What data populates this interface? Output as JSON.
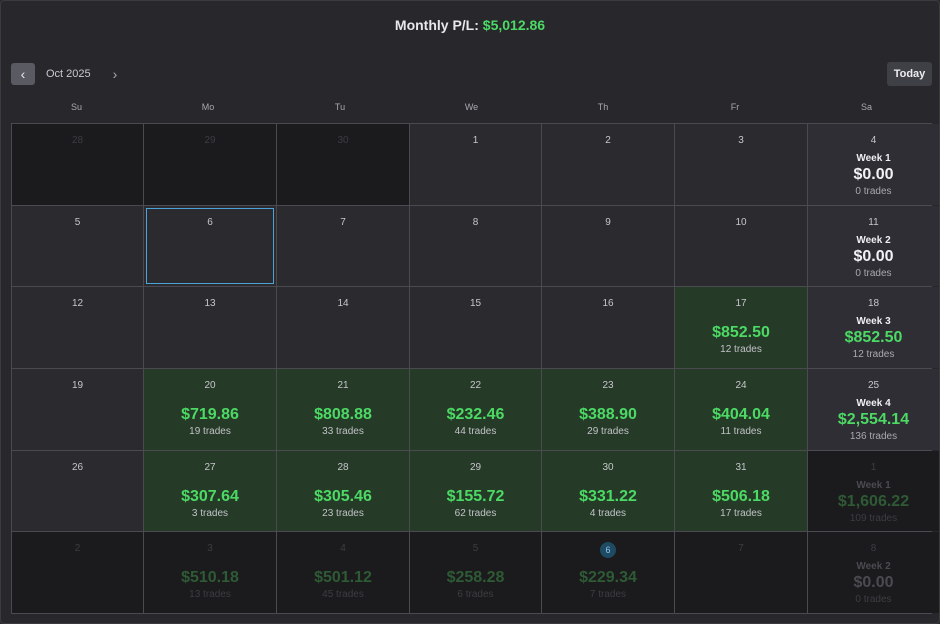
{
  "header": {
    "label": "Monthly P/L:",
    "amount": "$5,012.86",
    "positive_color": "#4cd964"
  },
  "nav": {
    "prev_icon": "chevron-left-icon",
    "next_icon": "chevron-right-icon",
    "month": "Oct 2025",
    "today_label": "Today"
  },
  "weekdays": [
    "Su",
    "Mo",
    "Tu",
    "We",
    "Th",
    "Fr",
    "Sa"
  ],
  "weeks": [
    {
      "days": [
        {
          "day": "28",
          "other": true
        },
        {
          "day": "29",
          "other": true
        },
        {
          "day": "30",
          "other": true
        },
        {
          "day": "1"
        },
        {
          "day": "2"
        },
        {
          "day": "3"
        }
      ],
      "summary": {
        "day": "4",
        "label": "Week 1",
        "pl": "$0.00",
        "trades": "0 trades",
        "pos": false
      }
    },
    {
      "days": [
        {
          "day": "5"
        },
        {
          "day": "6",
          "selected": true
        },
        {
          "day": "7"
        },
        {
          "day": "8"
        },
        {
          "day": "9"
        },
        {
          "day": "10"
        }
      ],
      "summary": {
        "day": "11",
        "label": "Week 2",
        "pl": "$0.00",
        "trades": "0 trades",
        "pos": false
      }
    },
    {
      "days": [
        {
          "day": "12"
        },
        {
          "day": "13"
        },
        {
          "day": "14"
        },
        {
          "day": "15"
        },
        {
          "day": "16"
        },
        {
          "day": "17",
          "pl": "$852.50",
          "trades": "12 trades"
        }
      ],
      "summary": {
        "day": "18",
        "label": "Week 3",
        "pl": "$852.50",
        "trades": "12 trades",
        "pos": true
      }
    },
    {
      "days": [
        {
          "day": "19"
        },
        {
          "day": "20",
          "pl": "$719.86",
          "trades": "19 trades"
        },
        {
          "day": "21",
          "pl": "$808.88",
          "trades": "33 trades"
        },
        {
          "day": "22",
          "pl": "$232.46",
          "trades": "44 trades"
        },
        {
          "day": "23",
          "pl": "$388.90",
          "trades": "29 trades"
        },
        {
          "day": "24",
          "pl": "$404.04",
          "trades": "11 trades"
        }
      ],
      "summary": {
        "day": "25",
        "label": "Week 4",
        "pl": "$2,554.14",
        "trades": "136 trades",
        "pos": true
      }
    },
    {
      "days": [
        {
          "day": "26"
        },
        {
          "day": "27",
          "pl": "$307.64",
          "trades": "3 trades"
        },
        {
          "day": "28",
          "pl": "$305.46",
          "trades": "23 trades"
        },
        {
          "day": "29",
          "pl": "$155.72",
          "trades": "62 trades"
        },
        {
          "day": "30",
          "pl": "$331.22",
          "trades": "4 trades"
        },
        {
          "day": "31",
          "pl": "$506.18",
          "trades": "17 trades"
        }
      ],
      "summary": {
        "day": "1",
        "label": "Week 1",
        "pl": "$1,606.22",
        "trades": "109 trades",
        "pos": true,
        "other": true
      }
    },
    {
      "days": [
        {
          "day": "2",
          "other": true
        },
        {
          "day": "3",
          "other": true,
          "pl": "$510.18",
          "trades": "13 trades"
        },
        {
          "day": "4",
          "other": true,
          "pl": "$501.12",
          "trades": "45 trades"
        },
        {
          "day": "5",
          "other": true,
          "pl": "$258.28",
          "trades": "6 trades"
        },
        {
          "day": "6",
          "other": true,
          "today": true,
          "pl": "$229.34",
          "trades": "7 trades"
        },
        {
          "day": "7",
          "other": true
        }
      ],
      "summary": {
        "day": "8",
        "label": "Week 2",
        "pl": "$0.00",
        "trades": "0 trades",
        "pos": false,
        "other": true
      }
    }
  ]
}
